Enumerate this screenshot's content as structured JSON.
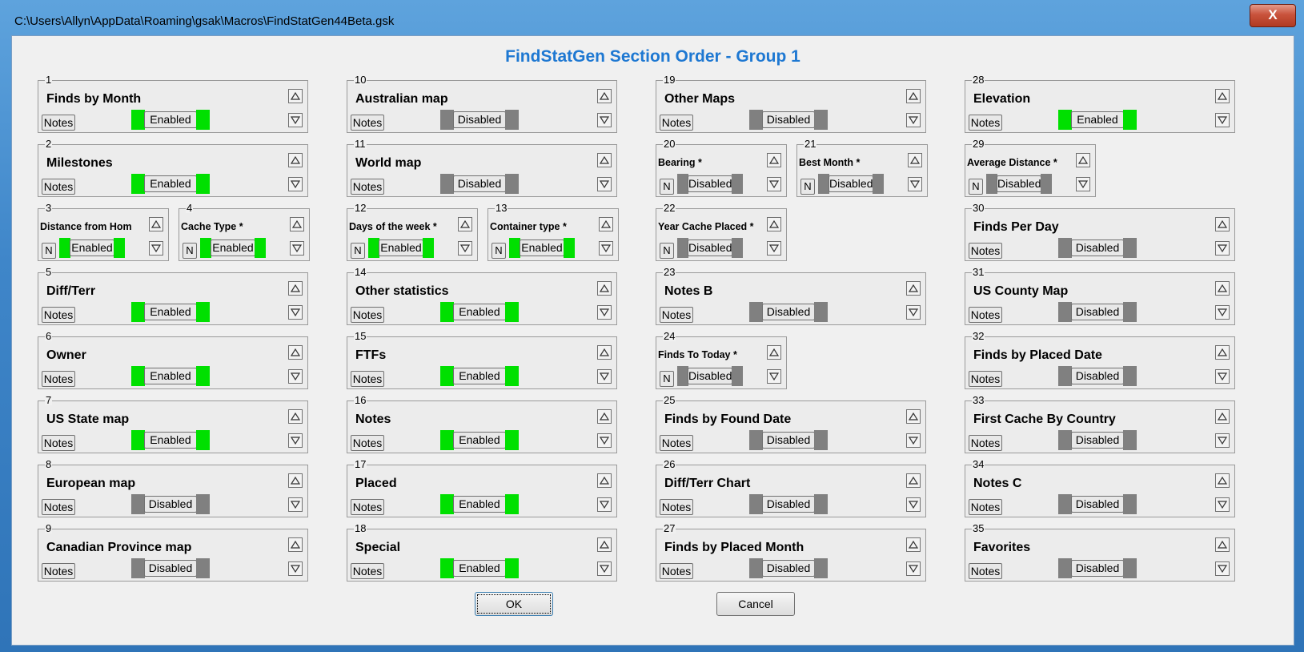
{
  "window": {
    "title": "C:\\Users\\Allyn\\AppData\\Roaming\\gsak\\Macros\\FindStatGen44Beta.gsk",
    "close_label": "X"
  },
  "dialog": {
    "heading": "FindStatGen Section Order - Group 1",
    "ok_label": "OK",
    "cancel_label": "Cancel",
    "notes_label": "Notes",
    "n_label": "N"
  },
  "sections": [
    {
      "num": "1",
      "name": "Finds by Month",
      "state": "Enabled"
    },
    {
      "num": "2",
      "name": "Milestones",
      "state": "Enabled"
    },
    {
      "num": "3",
      "name": "Distance from Hom",
      "state": "Enabled"
    },
    {
      "num": "4",
      "name": "Cache Type *",
      "state": "Enabled"
    },
    {
      "num": "5",
      "name": "Diff/Terr",
      "state": "Enabled"
    },
    {
      "num": "6",
      "name": "Owner",
      "state": "Enabled"
    },
    {
      "num": "7",
      "name": "US State map",
      "state": "Enabled"
    },
    {
      "num": "8",
      "name": "European map",
      "state": "Disabled"
    },
    {
      "num": "9",
      "name": "Canadian Province map",
      "state": "Disabled"
    },
    {
      "num": "10",
      "name": "Australian map",
      "state": "Disabled"
    },
    {
      "num": "11",
      "name": "World map",
      "state": "Disabled"
    },
    {
      "num": "12",
      "name": "Days of the week *",
      "state": "Enabled"
    },
    {
      "num": "13",
      "name": "Container type *",
      "state": "Enabled"
    },
    {
      "num": "14",
      "name": "Other statistics",
      "state": "Enabled"
    },
    {
      "num": "15",
      "name": "FTFs",
      "state": "Enabled"
    },
    {
      "num": "16",
      "name": "Notes",
      "state": "Enabled"
    },
    {
      "num": "17",
      "name": "Placed",
      "state": "Enabled"
    },
    {
      "num": "18",
      "name": "Special",
      "state": "Enabled"
    },
    {
      "num": "19",
      "name": "Other Maps",
      "state": "Disabled"
    },
    {
      "num": "20",
      "name": "Bearing *",
      "state": "Disabled"
    },
    {
      "num": "21",
      "name": "Best Month *",
      "state": "Disabled"
    },
    {
      "num": "22",
      "name": "Year Cache Placed *",
      "state": "Disabled"
    },
    {
      "num": "23",
      "name": "Notes B",
      "state": "Disabled"
    },
    {
      "num": "24",
      "name": "Finds To Today *",
      "state": "Disabled"
    },
    {
      "num": "25",
      "name": "Finds by Found Date",
      "state": "Disabled"
    },
    {
      "num": "26",
      "name": "Diff/Terr Chart",
      "state": "Disabled"
    },
    {
      "num": "27",
      "name": "Finds by Placed Month",
      "state": "Disabled"
    },
    {
      "num": "28",
      "name": "Elevation",
      "state": "Enabled"
    },
    {
      "num": "29",
      "name": "Average Distance *",
      "state": "Disabled"
    },
    {
      "num": "30",
      "name": "Finds Per Day",
      "state": "Disabled"
    },
    {
      "num": "31",
      "name": "US County Map",
      "state": "Disabled"
    },
    {
      "num": "32",
      "name": "Finds by Placed Date",
      "state": "Disabled"
    },
    {
      "num": "33",
      "name": "First Cache By Country",
      "state": "Disabled"
    },
    {
      "num": "34",
      "name": "Notes C",
      "state": "Disabled"
    },
    {
      "num": "35",
      "name": "Favorites",
      "state": "Disabled"
    }
  ]
}
